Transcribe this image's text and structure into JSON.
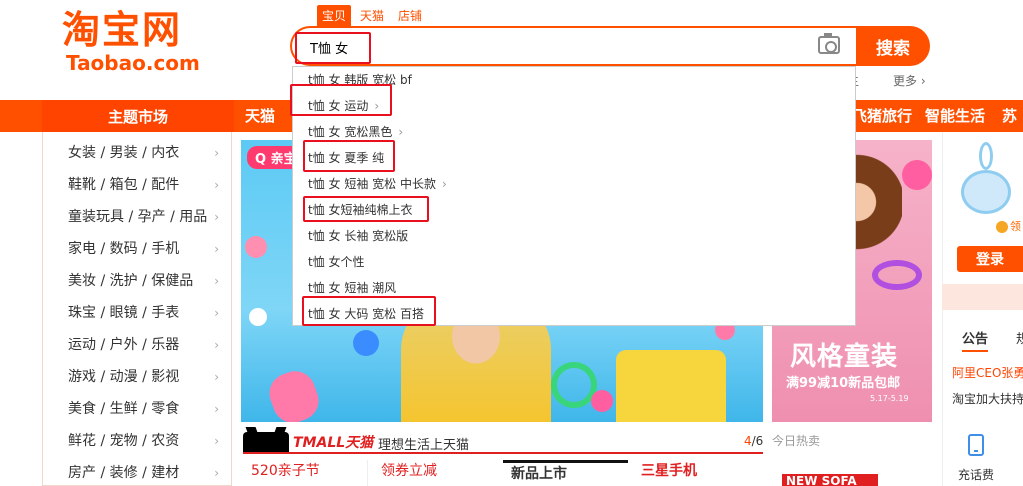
{
  "logo": {
    "cn": "淘宝网",
    "en": "Taobao.com"
  },
  "search": {
    "tabs": [
      "宝贝",
      "天猫",
      "店铺"
    ],
    "query": "T恤 女",
    "button": "搜索",
    "camera_icon": "camera-icon"
  },
  "header_links": {
    "more": "更多",
    "fragment": "主"
  },
  "suggestions": [
    {
      "text": "t恤 女 韩版 宽松 bf",
      "chevron": false
    },
    {
      "text": "t恤 女 运动",
      "chevron": true
    },
    {
      "text": "t恤 女 宽松黑色",
      "chevron": true
    },
    {
      "text": "t恤 女 夏季 纯",
      "chevron": false
    },
    {
      "text": "t恤 女 短袖 宽松 中长款",
      "chevron": true
    },
    {
      "text": "t恤 女短袖纯棉上衣",
      "chevron": false
    },
    {
      "text": "t恤 女 长袖 宽松版",
      "chevron": false
    },
    {
      "text": "t恤 女个性",
      "chevron": false
    },
    {
      "text": "t恤 女 短袖 潮风",
      "chevron": false
    },
    {
      "text": "t恤 女 大码 宽松 百搭",
      "chevron": false
    }
  ],
  "nav": {
    "theme": "主题市场",
    "items": [
      "天猫",
      "飞猪旅行",
      "智能生活",
      "苏宁"
    ]
  },
  "sidebar": [
    "女装 / 男装 / 内衣",
    "鞋靴 / 箱包 / 配件",
    "童装玩具 / 孕产 / 用品",
    "家电 / 数码 / 手机",
    "美妆 / 洗护 / 保健品",
    "珠宝 / 眼镜 / 手表",
    "运动 / 户外 / 乐器",
    "游戏 / 动漫 / 影视",
    "美食 / 生鲜 / 零食",
    "鲜花 / 宠物 / 农资",
    "房产 / 装修 / 建材"
  ],
  "banner": {
    "badge": "Q 亲宝"
  },
  "right_banner": {
    "title": "风格童装",
    "subtitle": "满99减10新品包邮",
    "date": "5.17-5.19"
  },
  "user_panel": {
    "coin_text": "领",
    "login": "登录",
    "notice_tab": "公告",
    "notice_extra": "规",
    "notice_1": "阿里CEO张勇",
    "notice_2": "淘宝加大扶持",
    "recharge": "充话费"
  },
  "tmall_strip": {
    "logo": "TMALL天猫",
    "slogan": "理想生活上天猫",
    "page_current": "4",
    "page_total": "/6",
    "promos": [
      "520亲子节",
      "领券立减",
      "新品上市",
      "三星手机"
    ],
    "hot_today": "今日热卖",
    "new_sofa": "NEW SOFA"
  },
  "colors": {
    "brand": "#ff5000",
    "annotation": "#e8101e",
    "tmall": "#e02020"
  }
}
